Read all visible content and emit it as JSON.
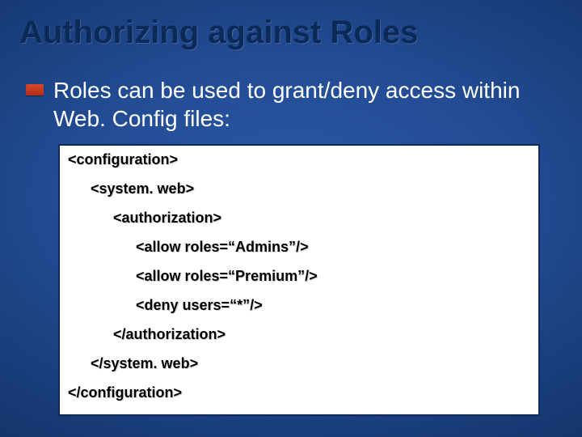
{
  "title": "Authorizing against Roles",
  "bullet": "Roles can be used to grant/deny access within Web. Config files:",
  "code": {
    "l0": "<configuration>",
    "l1": "<system. web>",
    "l2": "<authorization>",
    "l3": "<allow roles=“Admins”/>",
    "l4": "<allow roles=“Premium”/>",
    "l5": "<deny users=“*”/>",
    "l6": "</authorization>",
    "l7": "</system. web>",
    "l8": "</configuration>"
  }
}
